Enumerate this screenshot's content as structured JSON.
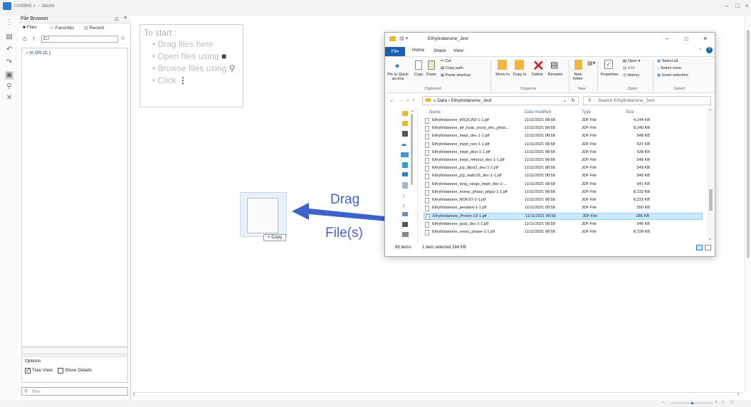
{
  "window": {
    "title": "Untitled.✓ - Jason"
  },
  "file_browser": {
    "title": "File Browser",
    "tabs": [
      {
        "label": "Files"
      },
      {
        "label": "Favorites"
      },
      {
        "label": "Recent"
      }
    ],
    "path_value": "C:/",
    "tree_item": "OS (C:)",
    "options_label": "Options",
    "tree_view_label": "Tree View",
    "show_details_label": "Show Details",
    "tree_view_checked": true,
    "show_details_checked": false,
    "filter_placeholder": "filter"
  },
  "start": {
    "heading": "To start :",
    "items": [
      "Drag files here",
      "Open files using",
      "Browse files using",
      "Click"
    ]
  },
  "explorer": {
    "title": "Ethylindanone_Jeol",
    "menu": {
      "file": "File",
      "home": "Home",
      "share": "Share",
      "view": "View"
    },
    "ribbon": {
      "pin": "Pin to Quick access",
      "copy": "Copy",
      "paste": "Paste",
      "cut": "Cut",
      "copy_path": "Copy path",
      "paste_shortcut": "Paste shortcut",
      "move_to": "Move to",
      "copy_to": "Copy to",
      "delete": "Delete",
      "rename": "Rename",
      "new_folder": "New folder",
      "properties": "Properties",
      "open": "Open",
      "edit": "Edit",
      "history": "History",
      "select_all": "Select all",
      "select_none": "Select none",
      "invert_selection": "Invert selection",
      "groups": [
        "Clipboard",
        "Organize",
        "New",
        "Open",
        "Select"
      ]
    },
    "address": "« Data › Ethylindanone_Jeol",
    "search_placeholder": "Search Ethylindanone_Jeol",
    "columns": [
      "Name",
      "Date modified",
      "Type",
      "Size"
    ],
    "files": [
      {
        "name": "Ethylindanone_HSQCAD-1-1.jdf",
        "date": "11/11/2021 08:58",
        "type": "JDF File",
        "size": "4,144 KB"
      },
      {
        "name": "Ethylindanone_idr_hsqc_tocsy_dec_phas...",
        "date": "11/11/2021 08:58",
        "type": "JDF File",
        "size": "8,240 KB"
      },
      {
        "name": "Ethylindanone_inept_dec-1-1.jdf",
        "date": "11/11/2021 08:58",
        "type": "JDF File",
        "size": "548 KB"
      },
      {
        "name": "Ethylindanone_inept_non-1-1.jdf",
        "date": "11/11/2021 08:58",
        "type": "JDF File",
        "size": "537 KB"
      },
      {
        "name": "Ethylindanone_inept_plus-1-1.jdf",
        "date": "11/11/2021 08:58",
        "type": "JDF File",
        "size": "538 KB"
      },
      {
        "name": "Ethylindanone_inept_refocus_dec-1-1.jdf",
        "date": "11/11/2021 08:58",
        "type": "JDF File",
        "size": "548 KB"
      },
      {
        "name": "Ethylindanone_jcp_dipsi2_dec-1-1.jdf",
        "date": "11/11/2021 08:58",
        "type": "JDF File",
        "size": "549 KB"
      },
      {
        "name": "Ethylindanone_jcp_waltz16_dec-1-1.jdf",
        "date": "11/11/2021 08:58",
        "type": "JDF File",
        "size": "549 KB"
      },
      {
        "name": "Ethylindanone_long_range_inept_dec-1-...",
        "date": "11/11/2021 08:58",
        "type": "JDF File",
        "size": "547 KB"
      },
      {
        "name": "Ethylindanone_noesy_phase_pfgzz-1-1.jdf",
        "date": "11/11/2021 08:58",
        "type": "JDF File",
        "size": "8,232 KB"
      },
      {
        "name": "Ethylindanone_NOESY-2-1.jdf",
        "date": "11/11/2021 08:58",
        "type": "JDF File",
        "size": "8,233 KB"
      },
      {
        "name": "Ethylindanone_pendant-1-1.jdf",
        "date": "11/11/2021 08:58",
        "type": "JDF File",
        "size": "550 KB"
      },
      {
        "name": "Ethylindanone_Proton-13-1.jdf",
        "date": "11/11/2021 08:58",
        "type": "JDF File",
        "size": "285 KB",
        "selected": true
      },
      {
        "name": "Ethylindanone_quat_dec-1-1.jdf",
        "date": "11/11/2021 08:58",
        "type": "JDF File",
        "size": "546 KB"
      },
      {
        "name": "Ethylindanone_roesy_phase-1-1.jdf",
        "date": "11/11/2021 08:58",
        "type": "JDF File",
        "size": "8,228 KB"
      }
    ],
    "status_count": "86 items",
    "status_selected": "1 item selected  284 KB"
  },
  "drag": {
    "copy_badge": "+ Copy",
    "label_line1": "Drag",
    "label_line2": "File(s)",
    "arrow_color": "#3b63c9"
  }
}
